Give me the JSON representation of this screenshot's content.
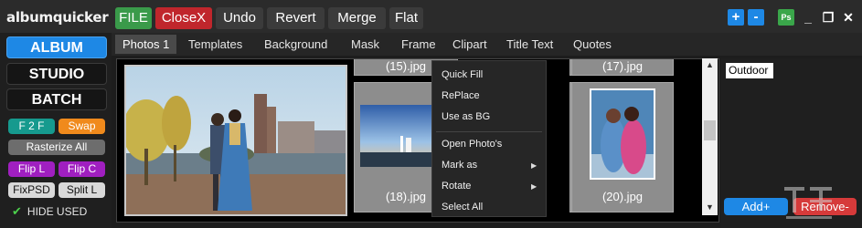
{
  "app": {
    "logo": "albumquicker"
  },
  "toolbar": {
    "file": "FILE",
    "closex": "CloseX",
    "undo": "Undo",
    "revert": "Revert",
    "merge": "Merge",
    "flat": "Flat"
  },
  "window_controls": {
    "zoom_in": "+",
    "zoom_out": "-",
    "ps": "Ps",
    "minimize": "_",
    "restore": "❐",
    "close": "✕"
  },
  "left": {
    "modes": [
      "ALBUM",
      "STUDIO",
      "BATCH"
    ],
    "buttons": {
      "f2f": "F 2 F",
      "swap": "Swap",
      "rasterize": "Rasterize All",
      "flip_l": "Flip L",
      "flip_c": "Flip C",
      "fixpsd": "FixPSD",
      "split_l": "Split L"
    },
    "hide_used": "HIDE USED"
  },
  "tabs": [
    "Photos 1",
    "Templates",
    "Background",
    "Mask",
    "Frame",
    "Clipart",
    "Title Text",
    "Quotes"
  ],
  "thumbs": {
    "t15": "(15).jpg",
    "t17": "(17).jpg",
    "t18": "(18).jpg",
    "t20": "(20).jpg"
  },
  "context_menu": {
    "items": [
      "Quick Fill",
      "RePlace",
      "Use as BG",
      "Open Photo's",
      "Mark as",
      "Rotate",
      "Select All"
    ]
  },
  "right": {
    "folder": "Outdoor",
    "add": "Add+",
    "remove": "Remove-"
  },
  "colors": {
    "accent": "#1e88e5",
    "green": "#3a9a4a",
    "red": "#c0262c"
  }
}
